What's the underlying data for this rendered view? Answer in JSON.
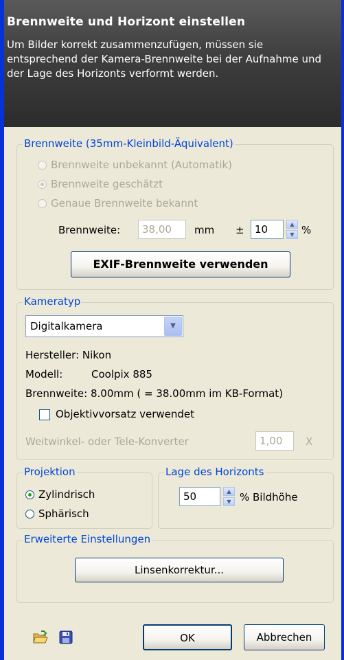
{
  "header": {
    "title": "Brennweite und Horizont einstellen",
    "description": "Um Bilder korrekt zusammenzufügen, müssen sie entsprechend der Kamera-Brennweite bei der Aufnahme und der Lage des Horizonts verformt werden."
  },
  "focal": {
    "legend": "Brennweite (35mm-Kleinbild-Äquivalent)",
    "options": [
      "Brennweite unbekannt (Automatik)",
      "Brennweite geschätzt",
      "Genaue Brennweite bekannt"
    ],
    "selected_index": 1,
    "label": "Brennweite:",
    "value": "38,00",
    "unit": "mm",
    "plusminus": "±",
    "tolerance": "10",
    "percent": "%",
    "exif_button": "EXIF-Brennweite verwenden"
  },
  "camera": {
    "legend": "Kameratyp",
    "type_value": "Digitalkamera",
    "manufacturer": "Hersteller: Nikon",
    "model_label": "Modell:",
    "model_value": "Coolpix 885",
    "focal_info": "Brennweite: 8.00mm ( = 38.00mm im KB-Format)",
    "lens_checkbox_label": "Objektivvorsatz verwendet",
    "lens_checked": false,
    "converter_label": "Weitwinkel- oder Tele-Konverter",
    "converter_value": "1,00",
    "converter_unit": "X"
  },
  "projection": {
    "legend": "Projektion",
    "options": [
      "Zylindrisch",
      "Sphärisch"
    ],
    "selected_index": 0
  },
  "horizon": {
    "legend": "Lage des Horizonts",
    "value": "50",
    "unit": "% Bildhöhe"
  },
  "advanced": {
    "legend": "Erweiterte Einstellungen",
    "lens_button": "Linsenkorrektur..."
  },
  "footer": {
    "ok": "OK",
    "cancel": "Abbrechen",
    "icons": [
      "open-folder-icon",
      "save-disk-icon"
    ]
  },
  "colors": {
    "frame": "#0831D9",
    "legend": "#0046D5",
    "background": "#ECE9D8",
    "radio_dot": "#21A121"
  }
}
